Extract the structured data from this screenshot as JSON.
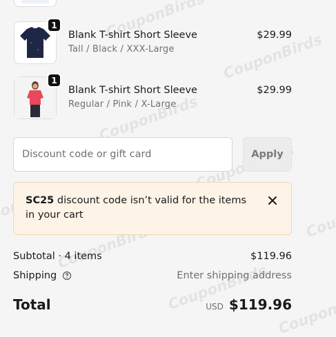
{
  "watermark": "CouponBirds",
  "items": [
    {
      "quantity": "1",
      "name": "Blank T-shirt Short Sleeve",
      "variant": "Tall / Black / XXX-Large",
      "price": "$29.99",
      "shirt_color": "#1e2746",
      "image": "navy-tshirt-image"
    },
    {
      "quantity": "1",
      "name": "Blank T-shirt Short Sleeve",
      "variant": "Regular / Pink / X-Large",
      "price": "$29.99",
      "shirt_color": "#e8475e",
      "image": "pink-tshirt-model-image"
    }
  ],
  "discount": {
    "placeholder": "Discount code or gift card",
    "apply_label": "Apply"
  },
  "alert": {
    "code": "SC25",
    "message": " discount code isn’t valid for the items in your cart"
  },
  "summary": {
    "subtotal_label": "Subtotal · 4 items",
    "subtotal_value": "$119.96",
    "shipping_label": "Shipping",
    "shipping_value": "Enter shipping address",
    "total_label": "Total",
    "currency": "USD",
    "total_value": "$119.96"
  },
  "colors": {
    "alert_bg": "#fdf3e6",
    "alert_border": "#f1d8b0",
    "badge": "#111111"
  }
}
